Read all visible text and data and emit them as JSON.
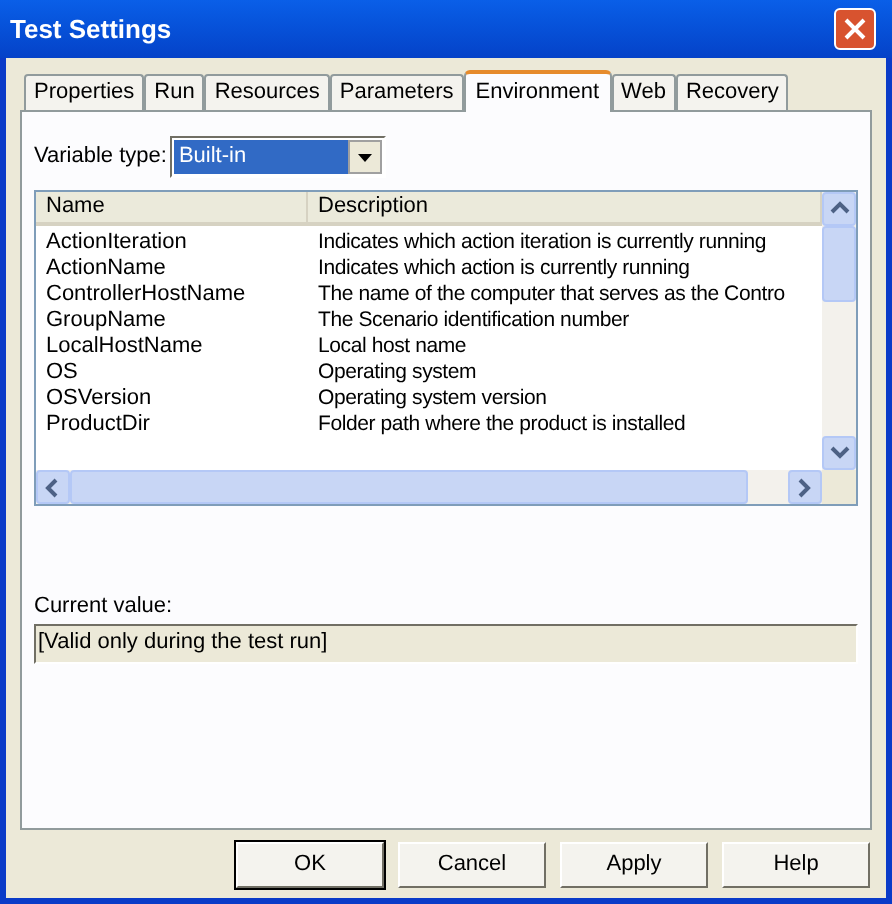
{
  "window": {
    "title": "Test Settings"
  },
  "tabs": [
    {
      "label": "Properties",
      "selected": false
    },
    {
      "label": "Run",
      "selected": false
    },
    {
      "label": "Resources",
      "selected": false
    },
    {
      "label": "Parameters",
      "selected": false
    },
    {
      "label": "Environment",
      "selected": true
    },
    {
      "label": "Web",
      "selected": false
    },
    {
      "label": "Recovery",
      "selected": false
    }
  ],
  "variable_type": {
    "label": "Variable type:",
    "value": "Built-in"
  },
  "table": {
    "columns": [
      "Name",
      "Description"
    ],
    "rows": [
      [
        "ActionIteration",
        "Indicates which action iteration is currently running"
      ],
      [
        "ActionName",
        "Indicates which action is currently running"
      ],
      [
        "ControllerHostName",
        "The name of the computer that serves as the Contro"
      ],
      [
        "GroupName",
        "The Scenario identification number"
      ],
      [
        "LocalHostName",
        "Local host name"
      ],
      [
        "OS",
        "Operating system"
      ],
      [
        "OSVersion",
        "Operating system version"
      ],
      [
        "ProductDir",
        "Folder path where the product is installed"
      ]
    ]
  },
  "current_value": {
    "label": "Current value:",
    "value": "[Valid only during the test run]"
  },
  "buttons": [
    {
      "label": "OK",
      "default": true
    },
    {
      "label": "Cancel",
      "default": false
    },
    {
      "label": "Apply",
      "default": false
    },
    {
      "label": "Help",
      "default": false
    }
  ]
}
